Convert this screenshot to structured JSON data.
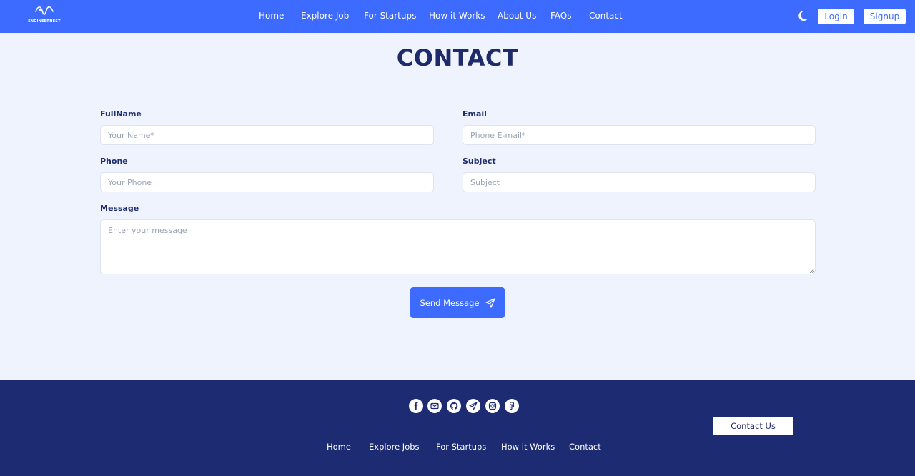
{
  "header": {
    "brand_name": "ENGINEERNEST",
    "nav": [
      "Home",
      "Explore Job",
      "For Startups",
      "How it Works",
      "About Us",
      "FAQs",
      "Contact"
    ],
    "login_label": "Login",
    "signup_label": "Signup"
  },
  "page": {
    "title": "CONTACT"
  },
  "form": {
    "fullname_label": "FullName",
    "fullname_placeholder": "Your Name*",
    "email_label": "Email",
    "email_placeholder": "Phone E-mail*",
    "phone_label": "Phone",
    "phone_placeholder": "Your Phone",
    "subject_label": "Subject",
    "subject_placeholder": "Subject",
    "message_label": "Message",
    "message_placeholder": "Enter your message",
    "send_label": "Send Message"
  },
  "footer": {
    "social_icons": [
      "facebook-icon",
      "gmail-icon",
      "github-icon",
      "telegram-icon",
      "instagram-icon",
      "figma-icon"
    ],
    "links": [
      "Home",
      "Explore Jobs",
      "For Startups",
      "How it Works",
      "Contact"
    ],
    "contact_button_label": "Contact Us"
  },
  "colors": {
    "primary": "#3d6bff",
    "navy": "#1c2b72",
    "background": "#eff3fd"
  }
}
